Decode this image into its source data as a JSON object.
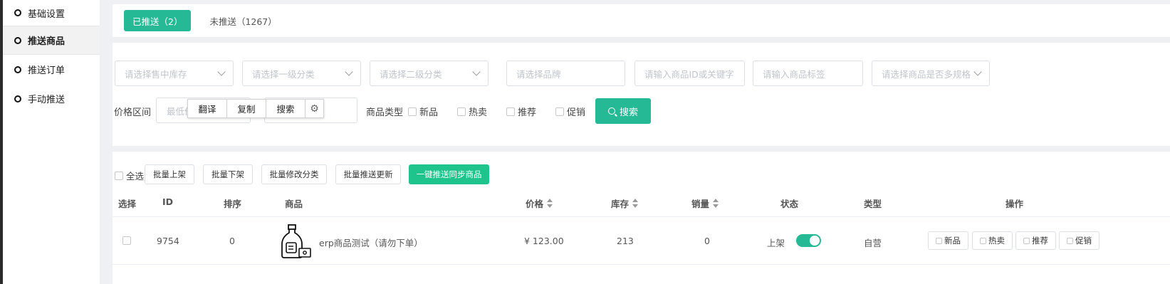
{
  "sidebar": {
    "items": [
      {
        "label": "基础设置"
      },
      {
        "label": "推送商品"
      },
      {
        "label": "推送订单"
      },
      {
        "label": "手动推送"
      }
    ]
  },
  "tabs": [
    {
      "label": "已推送（2）"
    },
    {
      "label": "未推送（1267）"
    }
  ],
  "filters": {
    "warehouse_placeholder": "请选择售中库存",
    "cat1_placeholder": "请选择一级分类",
    "cat2_placeholder": "请选择二级分类",
    "brand_placeholder": "请选择品牌",
    "keyword_placeholder": "请输入商品ID或关键字",
    "tag_placeholder": "请输入商品标签",
    "spec_placeholder": "请选择商品是否多规格",
    "price_label": "价格区间",
    "price_min_placeholder": "最低价",
    "type_label": "商品类型",
    "types": [
      "新品",
      "热卖",
      "推荐",
      "促销"
    ],
    "search_label": "搜索"
  },
  "context_menu": {
    "translate": "翻译",
    "copy": "复制",
    "search": "搜索"
  },
  "toolbar": {
    "select_all": "全选",
    "batch_up": "批量上架",
    "batch_down": "批量下架",
    "batch_edit_cat": "批量修改分类",
    "batch_push_update": "批量推送更新",
    "one_click_sync": "一键推送同步商品"
  },
  "table": {
    "headers": {
      "select": "选择",
      "id": "ID",
      "sort": "排序",
      "product": "商品",
      "price": "价格",
      "stock": "库存",
      "sales": "销量",
      "status": "状态",
      "type": "类型",
      "actions": "操作"
    },
    "rows": [
      {
        "id": "9754",
        "sort": "0",
        "product": "erp商品测试（请勿下单）",
        "price": "¥ 123.00",
        "stock": "213",
        "sales": "0",
        "status": "上架",
        "status_on": true,
        "type": "自营",
        "actions": [
          "新品",
          "热卖",
          "推荐",
          "促销"
        ]
      }
    ]
  },
  "colors": {
    "accent": "#26b996",
    "sync_button": "#1ec48b"
  }
}
